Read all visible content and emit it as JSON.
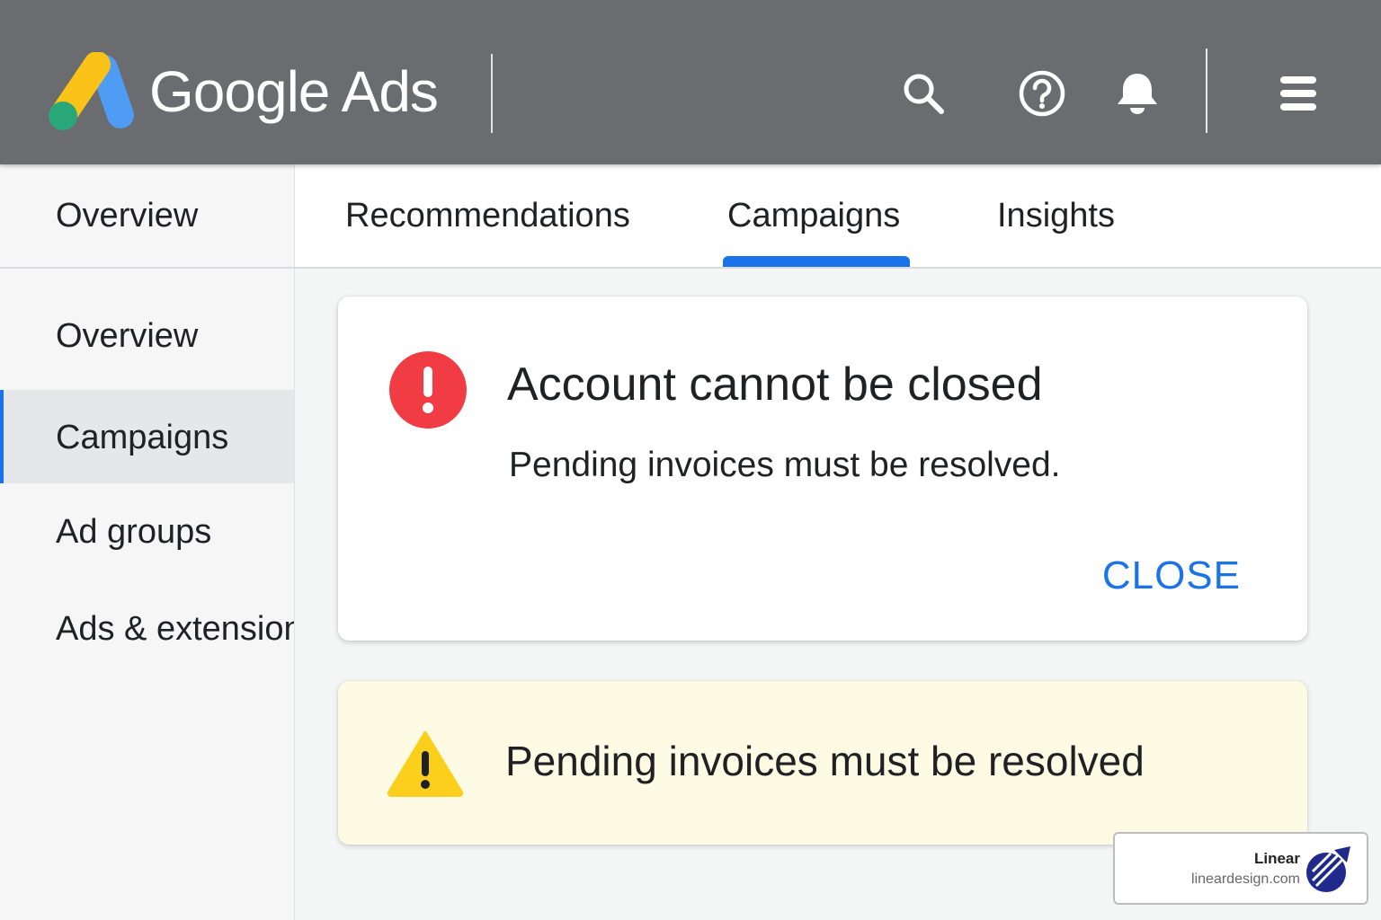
{
  "app": {
    "brand": "Google Ads"
  },
  "toolbar": {
    "icons": [
      "search-icon",
      "help-icon",
      "notifications-bell-icon",
      "menu-icon"
    ]
  },
  "nav": {
    "section": "Overview",
    "tabs": [
      {
        "label": "Recommendations"
      },
      {
        "label": "Campaigns",
        "active": true
      },
      {
        "label": "Insights"
      }
    ]
  },
  "sidebar": {
    "items": [
      {
        "label": "Overview"
      },
      {
        "label": "Campaigns",
        "active": true
      },
      {
        "label": "Ad groups"
      },
      {
        "label": "Ads & extensions"
      }
    ]
  },
  "dialog": {
    "title": "Account cannot be closed",
    "message": "Pending invoices must be resolved.",
    "close_label": "CLOSE",
    "icon": "error-icon"
  },
  "banner": {
    "text": "Pending invoices must be resolved",
    "icon": "warning-icon"
  },
  "watermark": {
    "name": "Linear",
    "url": "lineardesign.com"
  },
  "colors": {
    "topbar": "#6a6c70",
    "accent": "#1a73e8",
    "error": "#f23c44",
    "warning": "#fbcf1b",
    "banner_bg": "#fefbe4"
  }
}
